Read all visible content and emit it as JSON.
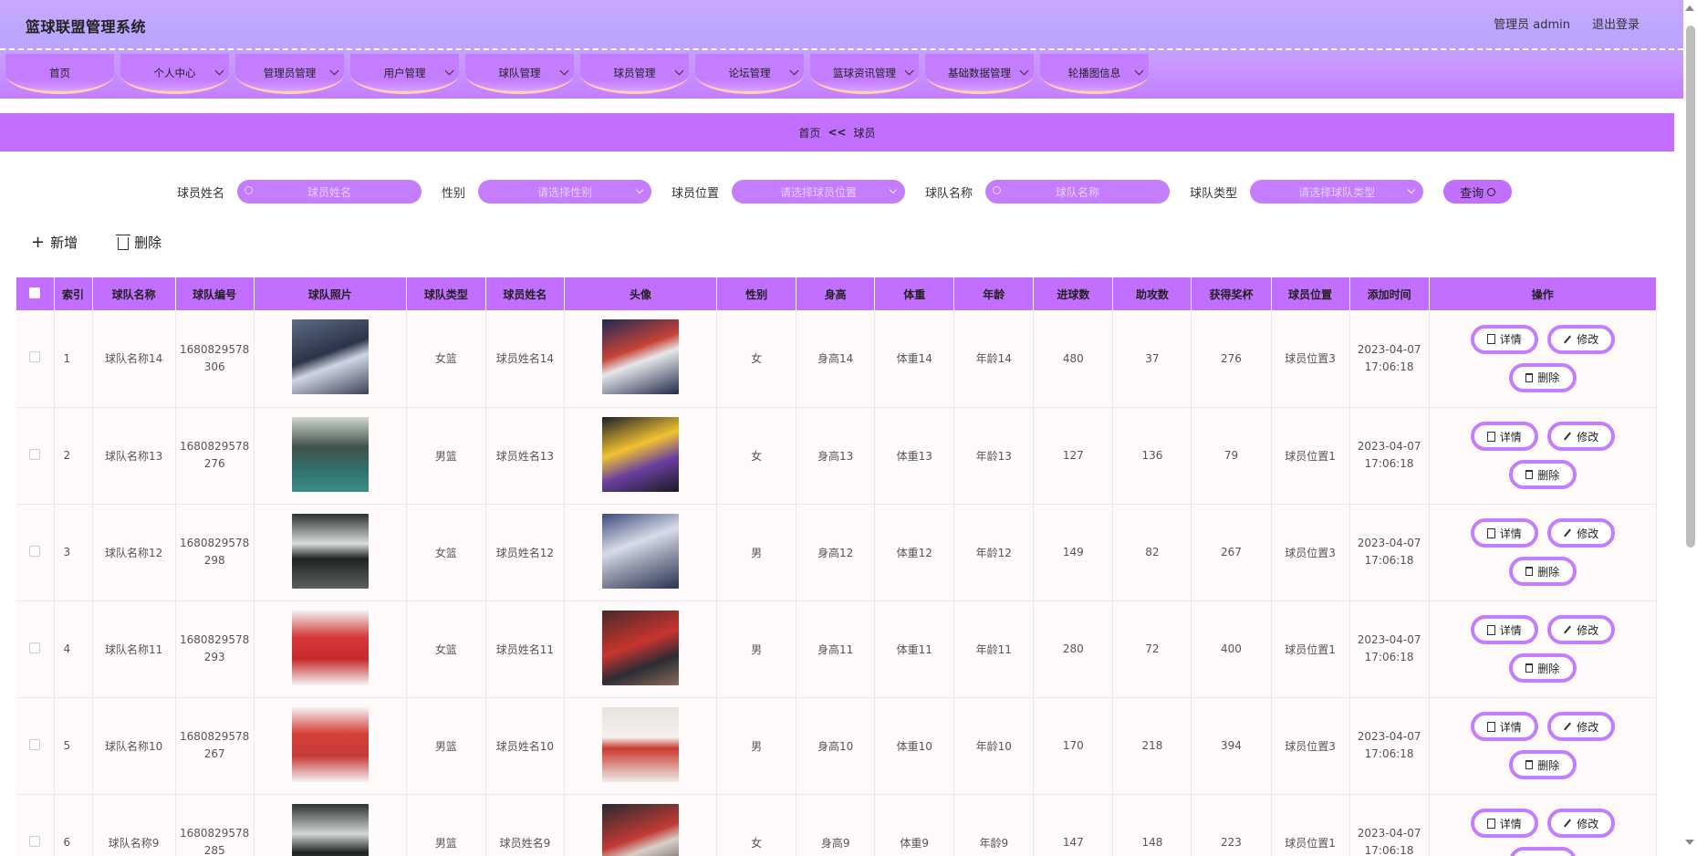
{
  "header": {
    "title": "篮球联盟管理系统",
    "admin_label": "管理员 admin",
    "logout_label": "退出登录"
  },
  "nav": [
    {
      "label": "首页",
      "has_dropdown": false
    },
    {
      "label": "个人中心",
      "has_dropdown": true
    },
    {
      "label": "管理员管理",
      "has_dropdown": true
    },
    {
      "label": "用户管理",
      "has_dropdown": true
    },
    {
      "label": "球队管理",
      "has_dropdown": true
    },
    {
      "label": "球员管理",
      "has_dropdown": true
    },
    {
      "label": "论坛管理",
      "has_dropdown": true
    },
    {
      "label": "篮球资讯管理",
      "has_dropdown": true
    },
    {
      "label": "基础数据管理",
      "has_dropdown": true
    },
    {
      "label": "轮播图信息",
      "has_dropdown": true
    }
  ],
  "breadcrumb": {
    "home": "首页",
    "separator": "<<",
    "current": "球员"
  },
  "search": {
    "player_name_label": "球员姓名",
    "player_name_placeholder": "球员姓名",
    "gender_label": "性别",
    "gender_placeholder": "请选择性别",
    "position_label": "球员位置",
    "position_placeholder": "请选择球员位置",
    "team_name_label": "球队名称",
    "team_name_placeholder": "球队名称",
    "team_type_label": "球队类型",
    "team_type_placeholder": "请选择球队类型",
    "query_label": "查询"
  },
  "toolbar": {
    "add_label": "新增",
    "delete_label": "删除"
  },
  "table": {
    "headers": [
      "索引",
      "球队名称",
      "球队编号",
      "球队照片",
      "球队类型",
      "球员姓名",
      "头像",
      "性别",
      "身高",
      "体重",
      "年龄",
      "进球数",
      "助攻数",
      "获得奖杯",
      "球员位置",
      "添加时间",
      "操作"
    ],
    "rows": [
      {
        "index": "1",
        "team_name": "球队名称14",
        "team_no_1": "1680829578",
        "team_no_2": "306",
        "team_type": "女篮",
        "player_name": "球员姓名14",
        "gender": "女",
        "height": "身高14",
        "weight": "体重14",
        "age": "年龄14",
        "goals": "480",
        "assists": "37",
        "trophies": "276",
        "position": "球员位置3",
        "date": "2023-04-07",
        "time": "17:06:18"
      },
      {
        "index": "2",
        "team_name": "球队名称13",
        "team_no_1": "1680829578",
        "team_no_2": "276",
        "team_type": "男篮",
        "player_name": "球员姓名13",
        "gender": "女",
        "height": "身高13",
        "weight": "体重13",
        "age": "年龄13",
        "goals": "127",
        "assists": "136",
        "trophies": "79",
        "position": "球员位置1",
        "date": "2023-04-07",
        "time": "17:06:18"
      },
      {
        "index": "3",
        "team_name": "球队名称12",
        "team_no_1": "1680829578",
        "team_no_2": "298",
        "team_type": "女篮",
        "player_name": "球员姓名12",
        "gender": "男",
        "height": "身高12",
        "weight": "体重12",
        "age": "年龄12",
        "goals": "149",
        "assists": "82",
        "trophies": "267",
        "position": "球员位置3",
        "date": "2023-04-07",
        "time": "17:06:18"
      },
      {
        "index": "4",
        "team_name": "球队名称11",
        "team_no_1": "1680829578",
        "team_no_2": "293",
        "team_type": "女篮",
        "player_name": "球员姓名11",
        "gender": "男",
        "height": "身高11",
        "weight": "体重11",
        "age": "年龄11",
        "goals": "280",
        "assists": "72",
        "trophies": "400",
        "position": "球员位置1",
        "date": "2023-04-07",
        "time": "17:06:18"
      },
      {
        "index": "5",
        "team_name": "球队名称10",
        "team_no_1": "1680829578",
        "team_no_2": "267",
        "team_type": "男篮",
        "player_name": "球员姓名10",
        "gender": "男",
        "height": "身高10",
        "weight": "体重10",
        "age": "年龄10",
        "goals": "170",
        "assists": "218",
        "trophies": "394",
        "position": "球员位置3",
        "date": "2023-04-07",
        "time": "17:06:18"
      },
      {
        "index": "6",
        "team_name": "球队名称9",
        "team_no_1": "1680829578",
        "team_no_2": "285",
        "team_type": "男篮",
        "player_name": "球员姓名9",
        "gender": "女",
        "height": "身高9",
        "weight": "体重9",
        "age": "年龄9",
        "goals": "147",
        "assists": "148",
        "trophies": "223",
        "position": "球员位置1",
        "date": "2023-04-07",
        "time": "17:06:18"
      }
    ],
    "ops": {
      "detail": "详情",
      "edit": "修改",
      "delete": "删除"
    }
  },
  "colors": {
    "accent": "#c26eff",
    "button_border": "#c57dff",
    "header_top": "#c9a8ff"
  }
}
